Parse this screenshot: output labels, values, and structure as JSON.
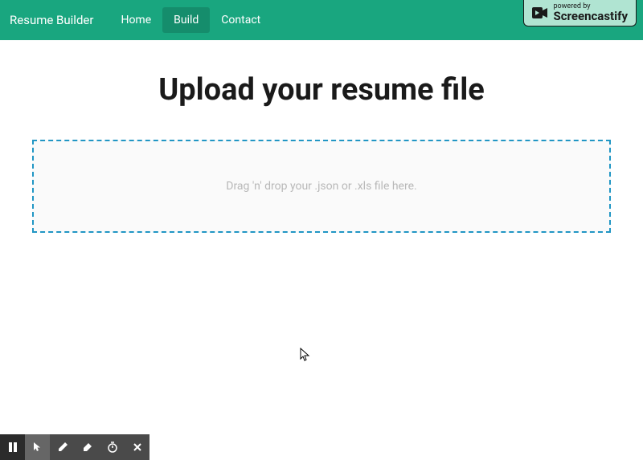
{
  "nav": {
    "brand": "Resume Builder",
    "links": [
      {
        "label": "Home",
        "active": false
      },
      {
        "label": "Build",
        "active": true
      },
      {
        "label": "Contact",
        "active": false
      }
    ]
  },
  "screencastify": {
    "powered": "powered by",
    "name": "Screencastify"
  },
  "page": {
    "title": "Upload your resume file",
    "dropzone_text": "Drag 'n' drop your .json or .xls file here."
  },
  "toolbar": {
    "pause": "pause-icon",
    "pointer": "pointer-icon",
    "pen": "pen-icon",
    "eraser": "eraser-icon",
    "timer": "timer-icon",
    "close": "close-icon"
  }
}
